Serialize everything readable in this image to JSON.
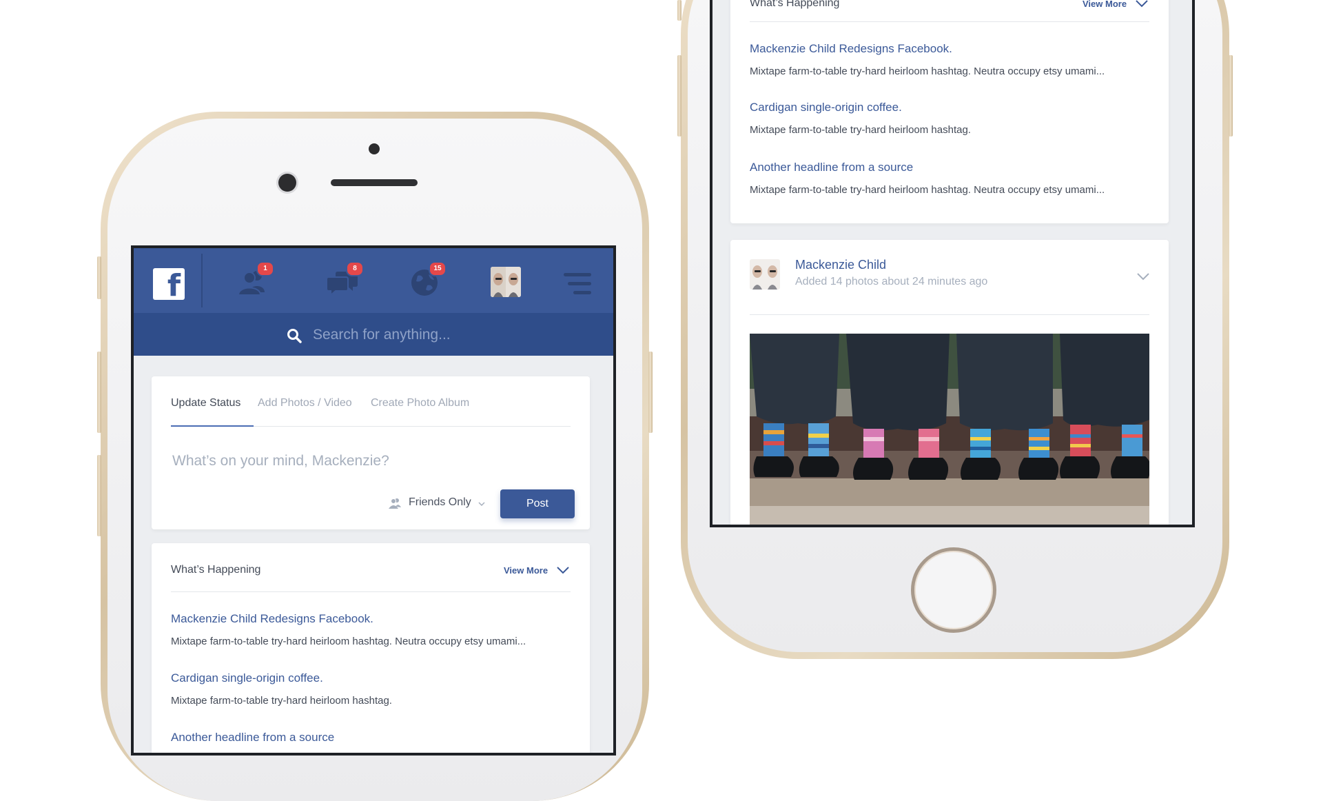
{
  "navbar": {
    "logo": "f",
    "friends_badge": "1",
    "messages_badge": "8",
    "notifications_badge": "15"
  },
  "search": {
    "placeholder": "Search for anything..."
  },
  "composer": {
    "tabs": [
      "Update Status",
      "Add Photos / Video",
      "Create Photo Album"
    ],
    "placeholder": "What’s on your mind, Mackenzie?",
    "privacy": "Friends Only",
    "post_label": "Post"
  },
  "whats_happening": {
    "title": "What’s Happening",
    "view_more": "View More",
    "items": [
      {
        "headline": "Mackenzie Child Redesigns Facebook.",
        "snippet": "Mixtape farm-to-table try-hard heirloom hashtag. Neutra occupy etsy umami..."
      },
      {
        "headline": "Cardigan single-origin coffee.",
        "snippet": "Mixtape farm-to-table try-hard heirloom hashtag."
      },
      {
        "headline": "Another headline from a source",
        "snippet": "Mixtape farm-to-table try-hard heirloom hashtag. Neutra occupy etsy umami..."
      }
    ]
  },
  "post": {
    "author": "Mackenzie Child",
    "meta": "Added 14 photos about 24 minutes ago"
  },
  "icons": {
    "logo": "facebook-logo-icon",
    "friends": "friends-icon",
    "messages": "messages-icon",
    "globe": "globe-icon",
    "menu": "menu-icon",
    "search": "search-icon",
    "privacy": "friends-privacy-icon",
    "chevron": "chevron-down-icon"
  },
  "colors": {
    "brand": "#3b5998",
    "search_bar": "#2f4d8a",
    "badge": "#e4484a",
    "background": "#eceef1"
  }
}
